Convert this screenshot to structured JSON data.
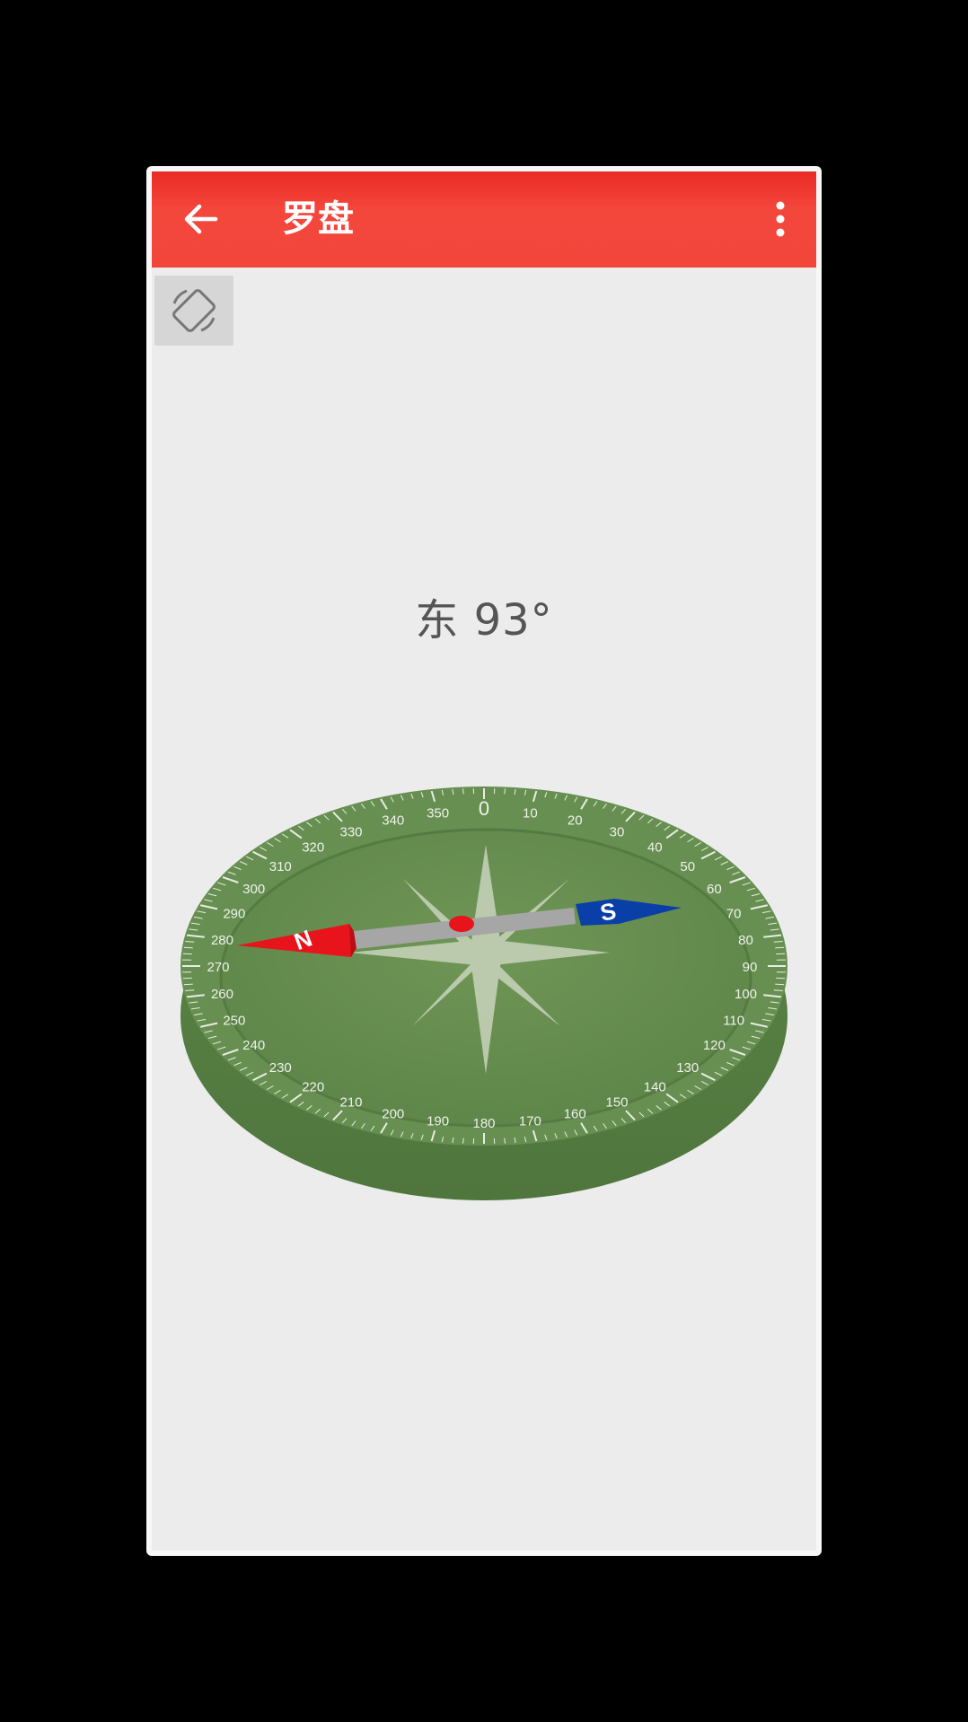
{
  "appbar": {
    "title": "罗盘",
    "back_icon": "arrow-left-icon",
    "menu_icon": "more-vertical-icon"
  },
  "toolbar": {
    "rotate_icon": "screen-rotation-icon"
  },
  "heading": {
    "direction": "东",
    "degrees": "93°"
  },
  "compass": {
    "heading_value": 93,
    "outer_ring_labels": [
      "350",
      "0",
      "10",
      "20",
      "30",
      "40",
      "50",
      "60",
      "70",
      "80",
      "90",
      "100",
      "110",
      "120",
      "130",
      "140",
      "150",
      "160",
      "170",
      "180",
      "190",
      "200",
      "210",
      "220",
      "230",
      "240",
      "250",
      "260",
      "270",
      "280",
      "290",
      "300",
      "310",
      "320",
      "330",
      "340"
    ],
    "needle_north_letter": "N",
    "needle_south_letter": "S"
  },
  "colors": {
    "appbar": "#f2463b",
    "compass_face": "#6a8f52",
    "needle_north": "#e8141c",
    "needle_south": "#0a3fa8",
    "background": "#ececec"
  }
}
